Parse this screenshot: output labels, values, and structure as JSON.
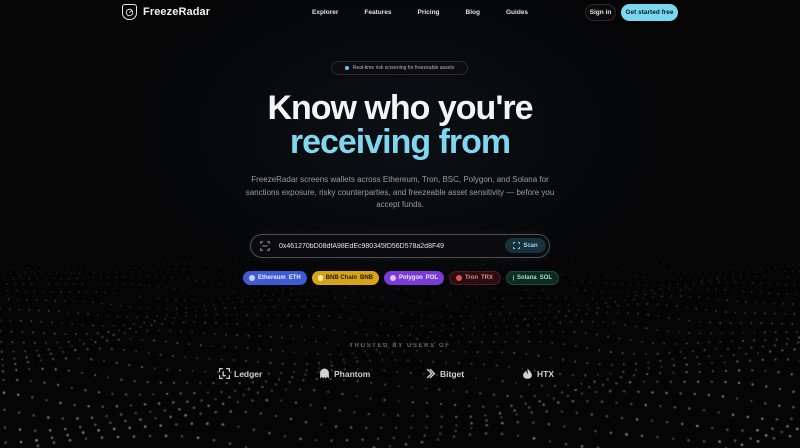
{
  "nav": {
    "brand": "FreezeRadar",
    "links": [
      "Explorer",
      "Features",
      "Pricing",
      "Blog",
      "Guides"
    ],
    "signin": "Sign in",
    "cta": "Get started free"
  },
  "hero": {
    "badge": "Real-time risk screening for freezeable assets",
    "title_line1": "Know who you're",
    "title_line2": "receiving from",
    "subtitle": "FreezeRadar screens wallets across Ethereum, Tron, BSC, Polygon, and Solana for sanctions exposure, risky counterparties, and freezeable asset sensitivity — before you accept funds."
  },
  "search": {
    "value": "0x461270bD08dfA98EdEc980345fD56D578a2d8F49",
    "button": "Scan",
    "icon": "scan-icon"
  },
  "chains": [
    {
      "label": "Ethereum",
      "ticker": "ETH",
      "color": "#3e5bd4"
    },
    {
      "label": "BNB Chain",
      "ticker": "BNB",
      "color": "#d6a417"
    },
    {
      "label": "Polygon",
      "ticker": "POL",
      "color": "#7a3bd6"
    },
    {
      "label": "Tron",
      "ticker": "TRX",
      "color": "#c0392b"
    },
    {
      "label": "Solana",
      "ticker": "SOL",
      "color": "#2ebd8e"
    }
  ],
  "trusted": {
    "label": "TRUSTED BY USERS OF",
    "logos": [
      "Ledger",
      "Phantom",
      "Bitget",
      "HTX"
    ]
  },
  "colors": {
    "accent": "#79d8f0",
    "background": "#050506"
  }
}
